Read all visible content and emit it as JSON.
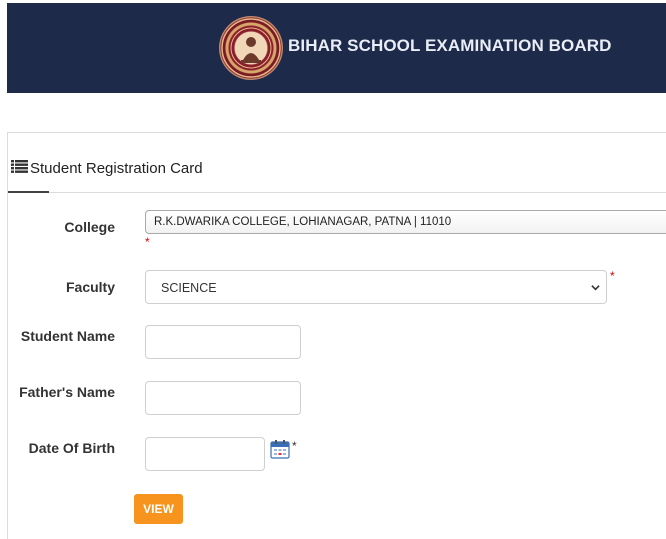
{
  "header": {
    "brand_text": "BIHAR SCHOOL EXAMINATION BOARD",
    "logo_icon": "bseb-seal-logo"
  },
  "card": {
    "title_icon": "list-icon",
    "title": "Student Registration Card"
  },
  "form": {
    "college": {
      "label": "College",
      "value": "R.K.DWARIKA COLLEGE, LOHIANAGAR, PATNA | 11010",
      "required_mark": "*"
    },
    "faculty": {
      "label": "Faculty",
      "value": "SCIENCE",
      "required_mark": "*"
    },
    "student_name": {
      "label": "Student Name",
      "value": ""
    },
    "fathers_name": {
      "label": "Father's Name",
      "value": ""
    },
    "date_of_birth": {
      "label": "Date Of Birth",
      "value": "",
      "icon": "calendar-icon",
      "required_mark": "*"
    },
    "submit_label": "VIEW"
  },
  "colors": {
    "header_bg": "#1e2a49",
    "button_bg": "#f7941d",
    "required": "#dd0000"
  }
}
